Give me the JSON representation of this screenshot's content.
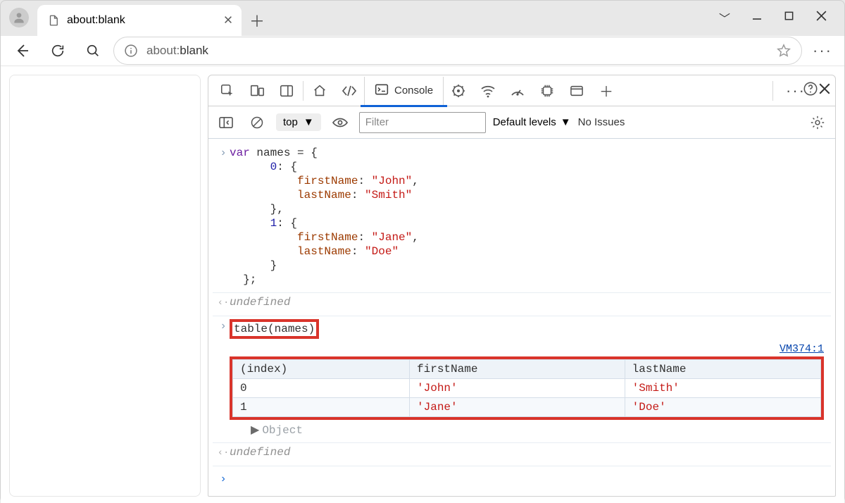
{
  "window": {
    "tab_title": "about:blank",
    "url_protocol": "about:",
    "url_rest": "blank"
  },
  "devtools": {
    "active_tab": "Console",
    "context": "top",
    "filter_placeholder": "Filter",
    "levels_label": "Default levels",
    "no_issues": "No Issues",
    "source_link": "VM374:1",
    "return_undefined": "undefined",
    "object_label": "Object"
  },
  "code_block": {
    "l1_var": "var",
    "l1_name": " names = {",
    "l2_key": "0",
    "l2_rest": ": {",
    "l3_prop": "firstName",
    "l3_sep": ": ",
    "l3_val": "\"John\"",
    "l3_end": ",",
    "l4_prop": "lastName",
    "l4_sep": ": ",
    "l4_val": "\"Smith\"",
    "l5": "},",
    "l6_key": "1",
    "l6_rest": ": {",
    "l7_prop": "firstName",
    "l7_sep": ": ",
    "l7_val": "\"Jane\"",
    "l7_end": ",",
    "l8_prop": "lastName",
    "l8_sep": ": ",
    "l8_val": "\"Doe\"",
    "l9": "}",
    "l10": "};"
  },
  "cmd2": {
    "text": "table(names)"
  },
  "table": {
    "headers": {
      "c0": "(index)",
      "c1": "firstName",
      "c2": "lastName"
    },
    "rows": [
      {
        "idx": "0",
        "first": "'John'",
        "last": "'Smith'"
      },
      {
        "idx": "1",
        "first": "'Jane'",
        "last": "'Doe'"
      }
    ]
  }
}
